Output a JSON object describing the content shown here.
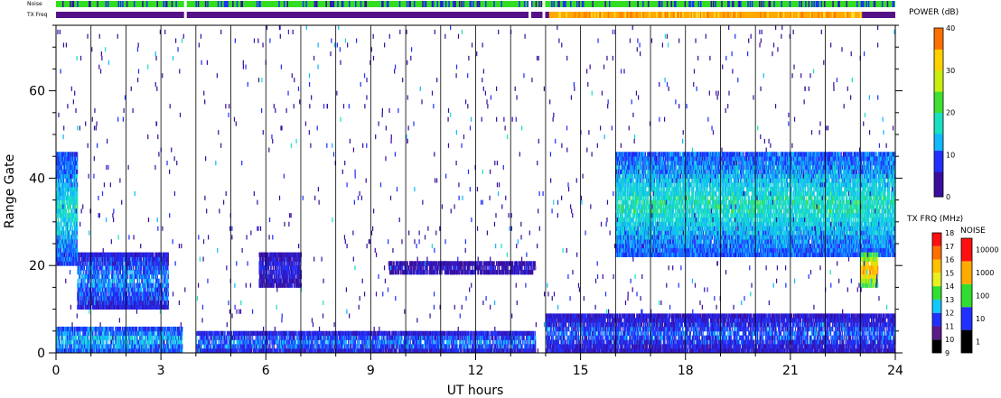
{
  "chart_data": {
    "type": "heatmap",
    "xlabel": "UT hours",
    "ylabel": "Range Gate",
    "xlim": [
      0,
      24
    ],
    "ylim": [
      0,
      75
    ],
    "xticks": [
      "0",
      "3",
      "6",
      "9",
      "12",
      "15",
      "18",
      "21",
      "24"
    ],
    "xtick_values": [
      0,
      3,
      6,
      9,
      12,
      15,
      18,
      21,
      24
    ],
    "yticks": [
      "0",
      "20",
      "40",
      "60"
    ],
    "ytick_values": [
      0,
      20,
      40,
      60
    ],
    "grid": "vertical lines every hour",
    "top_strips": [
      {
        "label": "Noise",
        "dominant_color": "#33dd22"
      },
      {
        "label": "TX Freq",
        "dominant_color": "#551188",
        "late_color": "#ffaa00",
        "late_start_hour": 14.1
      }
    ],
    "data_gaps_hours": [
      3.7,
      13.55,
      13.95
    ],
    "echo_regions": [
      {
        "x_start": 0.0,
        "x_end": 3.6,
        "gate_min": 0,
        "gate_max": 5,
        "power_db": 12
      },
      {
        "x_start": 0.6,
        "x_end": 3.2,
        "gate_min": 10,
        "gate_max": 22,
        "power_db": 10
      },
      {
        "x_start": 0.0,
        "x_end": 0.6,
        "gate_min": 20,
        "gate_max": 45,
        "power_db": 14
      },
      {
        "x_start": 4.0,
        "x_end": 13.7,
        "gate_min": 0,
        "gate_max": 4,
        "power_db": 9
      },
      {
        "x_start": 9.5,
        "x_end": 13.7,
        "gate_min": 18,
        "gate_max": 20,
        "power_db": 4
      },
      {
        "x_start": 5.8,
        "x_end": 7.0,
        "gate_min": 15,
        "gate_max": 22,
        "power_db": 6
      },
      {
        "x_start": 14.0,
        "x_end": 24.0,
        "gate_min": 0,
        "gate_max": 8,
        "power_db": 8
      },
      {
        "x_start": 16.0,
        "x_end": 24.0,
        "gate_min": 22,
        "gate_max": 45,
        "power_db": 15
      },
      {
        "x_start": 23.0,
        "x_end": 23.5,
        "gate_min": 15,
        "gate_max": 22,
        "power_db": 30
      }
    ],
    "colorbars": [
      {
        "title": "POWER (dB)",
        "ticks": [
          "0",
          "10",
          "20",
          "30",
          "40"
        ],
        "range": [
          0,
          40
        ]
      },
      {
        "title": "TX FRQ (MHz)",
        "ticks": [
          "9",
          "10",
          "11",
          "12",
          "13",
          "14",
          "15",
          "16",
          "17",
          "18"
        ]
      },
      {
        "title": "NOISE",
        "ticks": [
          "1",
          "10",
          "100",
          "1000",
          "10000"
        ]
      }
    ]
  },
  "legend": {
    "noise_label": "Noise",
    "txfreq_label": "TX Freq"
  }
}
